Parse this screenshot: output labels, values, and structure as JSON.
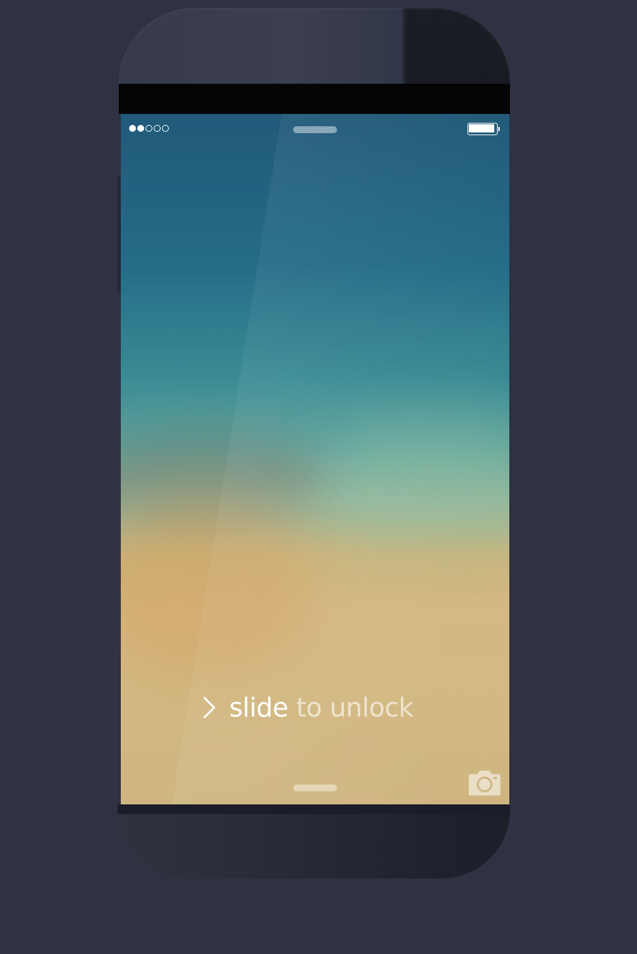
{
  "status_bar": {
    "signal_dots_total": 5,
    "signal_dots_filled": 2,
    "battery_level": 0.92
  },
  "lock_screen": {
    "slider": {
      "word_highlight": "slide",
      "word_rest": "to unlock"
    },
    "icons": {
      "signal": "signal-dots-icon",
      "battery": "battery-icon",
      "slider": "chevron-right-icon",
      "camera": "camera-icon"
    }
  },
  "colors": {
    "background": "#2f3242",
    "wallpaper_top": "#215979",
    "wallpaper_mid": "#5ea39c",
    "wallpaper_bottom": "#d3b982",
    "text_primary": "#ffffff"
  }
}
